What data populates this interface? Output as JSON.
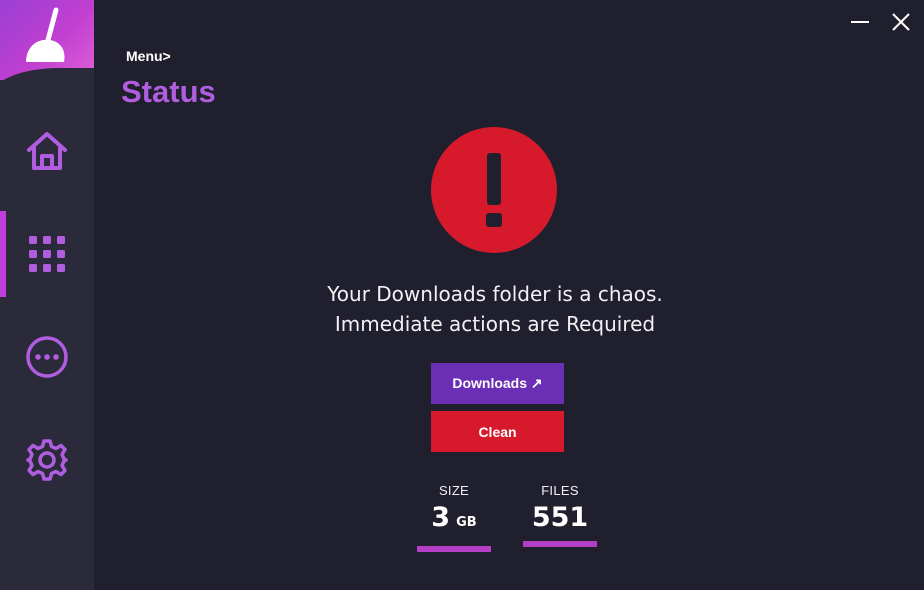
{
  "window": {
    "minimize_symbol": "—",
    "close_symbol": "✕"
  },
  "sidebar": {
    "logo_icon": "broom-icon",
    "items": [
      {
        "id": "home",
        "icon": "home-icon",
        "active": false
      },
      {
        "id": "menu",
        "icon": "grid-icon",
        "active": true
      },
      {
        "id": "more",
        "icon": "more-icon",
        "active": false
      },
      {
        "id": "settings",
        "icon": "gear-icon",
        "active": false
      }
    ]
  },
  "header": {
    "breadcrumb": "Menu>",
    "title": "Status"
  },
  "alert": {
    "icon": "exclamation-icon",
    "line1": "Your Downloads folder is a chaos.",
    "line2": "Immediate actions are Required"
  },
  "buttons": {
    "downloads_label": "Downloads ↗",
    "clean_label": "Clean"
  },
  "stats": {
    "size_label": "SIZE",
    "size_value": "3",
    "size_unit": "GB",
    "files_label": "FILES",
    "files_value": "551"
  },
  "colors": {
    "background": "#201f2d",
    "sidebar": "#2b2a3a",
    "accent": "#b05de0",
    "danger": "#d61a2c",
    "primary_button": "#6a2fb4",
    "underline": "#b43ec6"
  }
}
